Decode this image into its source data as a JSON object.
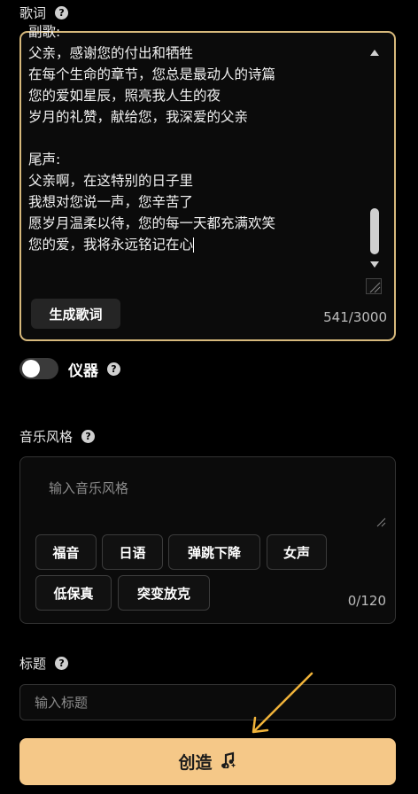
{
  "lyrics": {
    "label": "歌词",
    "lines": [
      "副歌:",
      "父亲，感谢您的付出和牺牲",
      "在每个生命的章节，您总是最动人的诗篇",
      "您的爱如星辰，照亮我人生的夜",
      "岁月的礼赞，献给您，我深爱的父亲",
      "",
      "尾声:",
      "父亲啊，在这特别的日子里",
      "我想对您说一声，您辛苦了",
      "愿岁月温柔以待，您的每一天都充满欢笑",
      "您的爱，我将永远铭记在心"
    ],
    "generate_button": "生成歌词",
    "char_count": "541/3000"
  },
  "instrument": {
    "label": "仪器",
    "enabled": false
  },
  "music_style": {
    "label": "音乐风格",
    "placeholder": "输入音乐风格",
    "tags": [
      "福音",
      "日语",
      "弹跳下降",
      "女声",
      "低保真",
      "突变放克"
    ],
    "char_count": "0/120"
  },
  "title_field": {
    "label": "标题",
    "placeholder": "输入标题"
  },
  "create_button": {
    "label": "创造",
    "icon": "music-note-sparkle-icon"
  },
  "help_icon_glyph": "?",
  "colors": {
    "accent": "#f5c888",
    "border_active": "#d7b97c",
    "arrow": "#f0b33a"
  }
}
